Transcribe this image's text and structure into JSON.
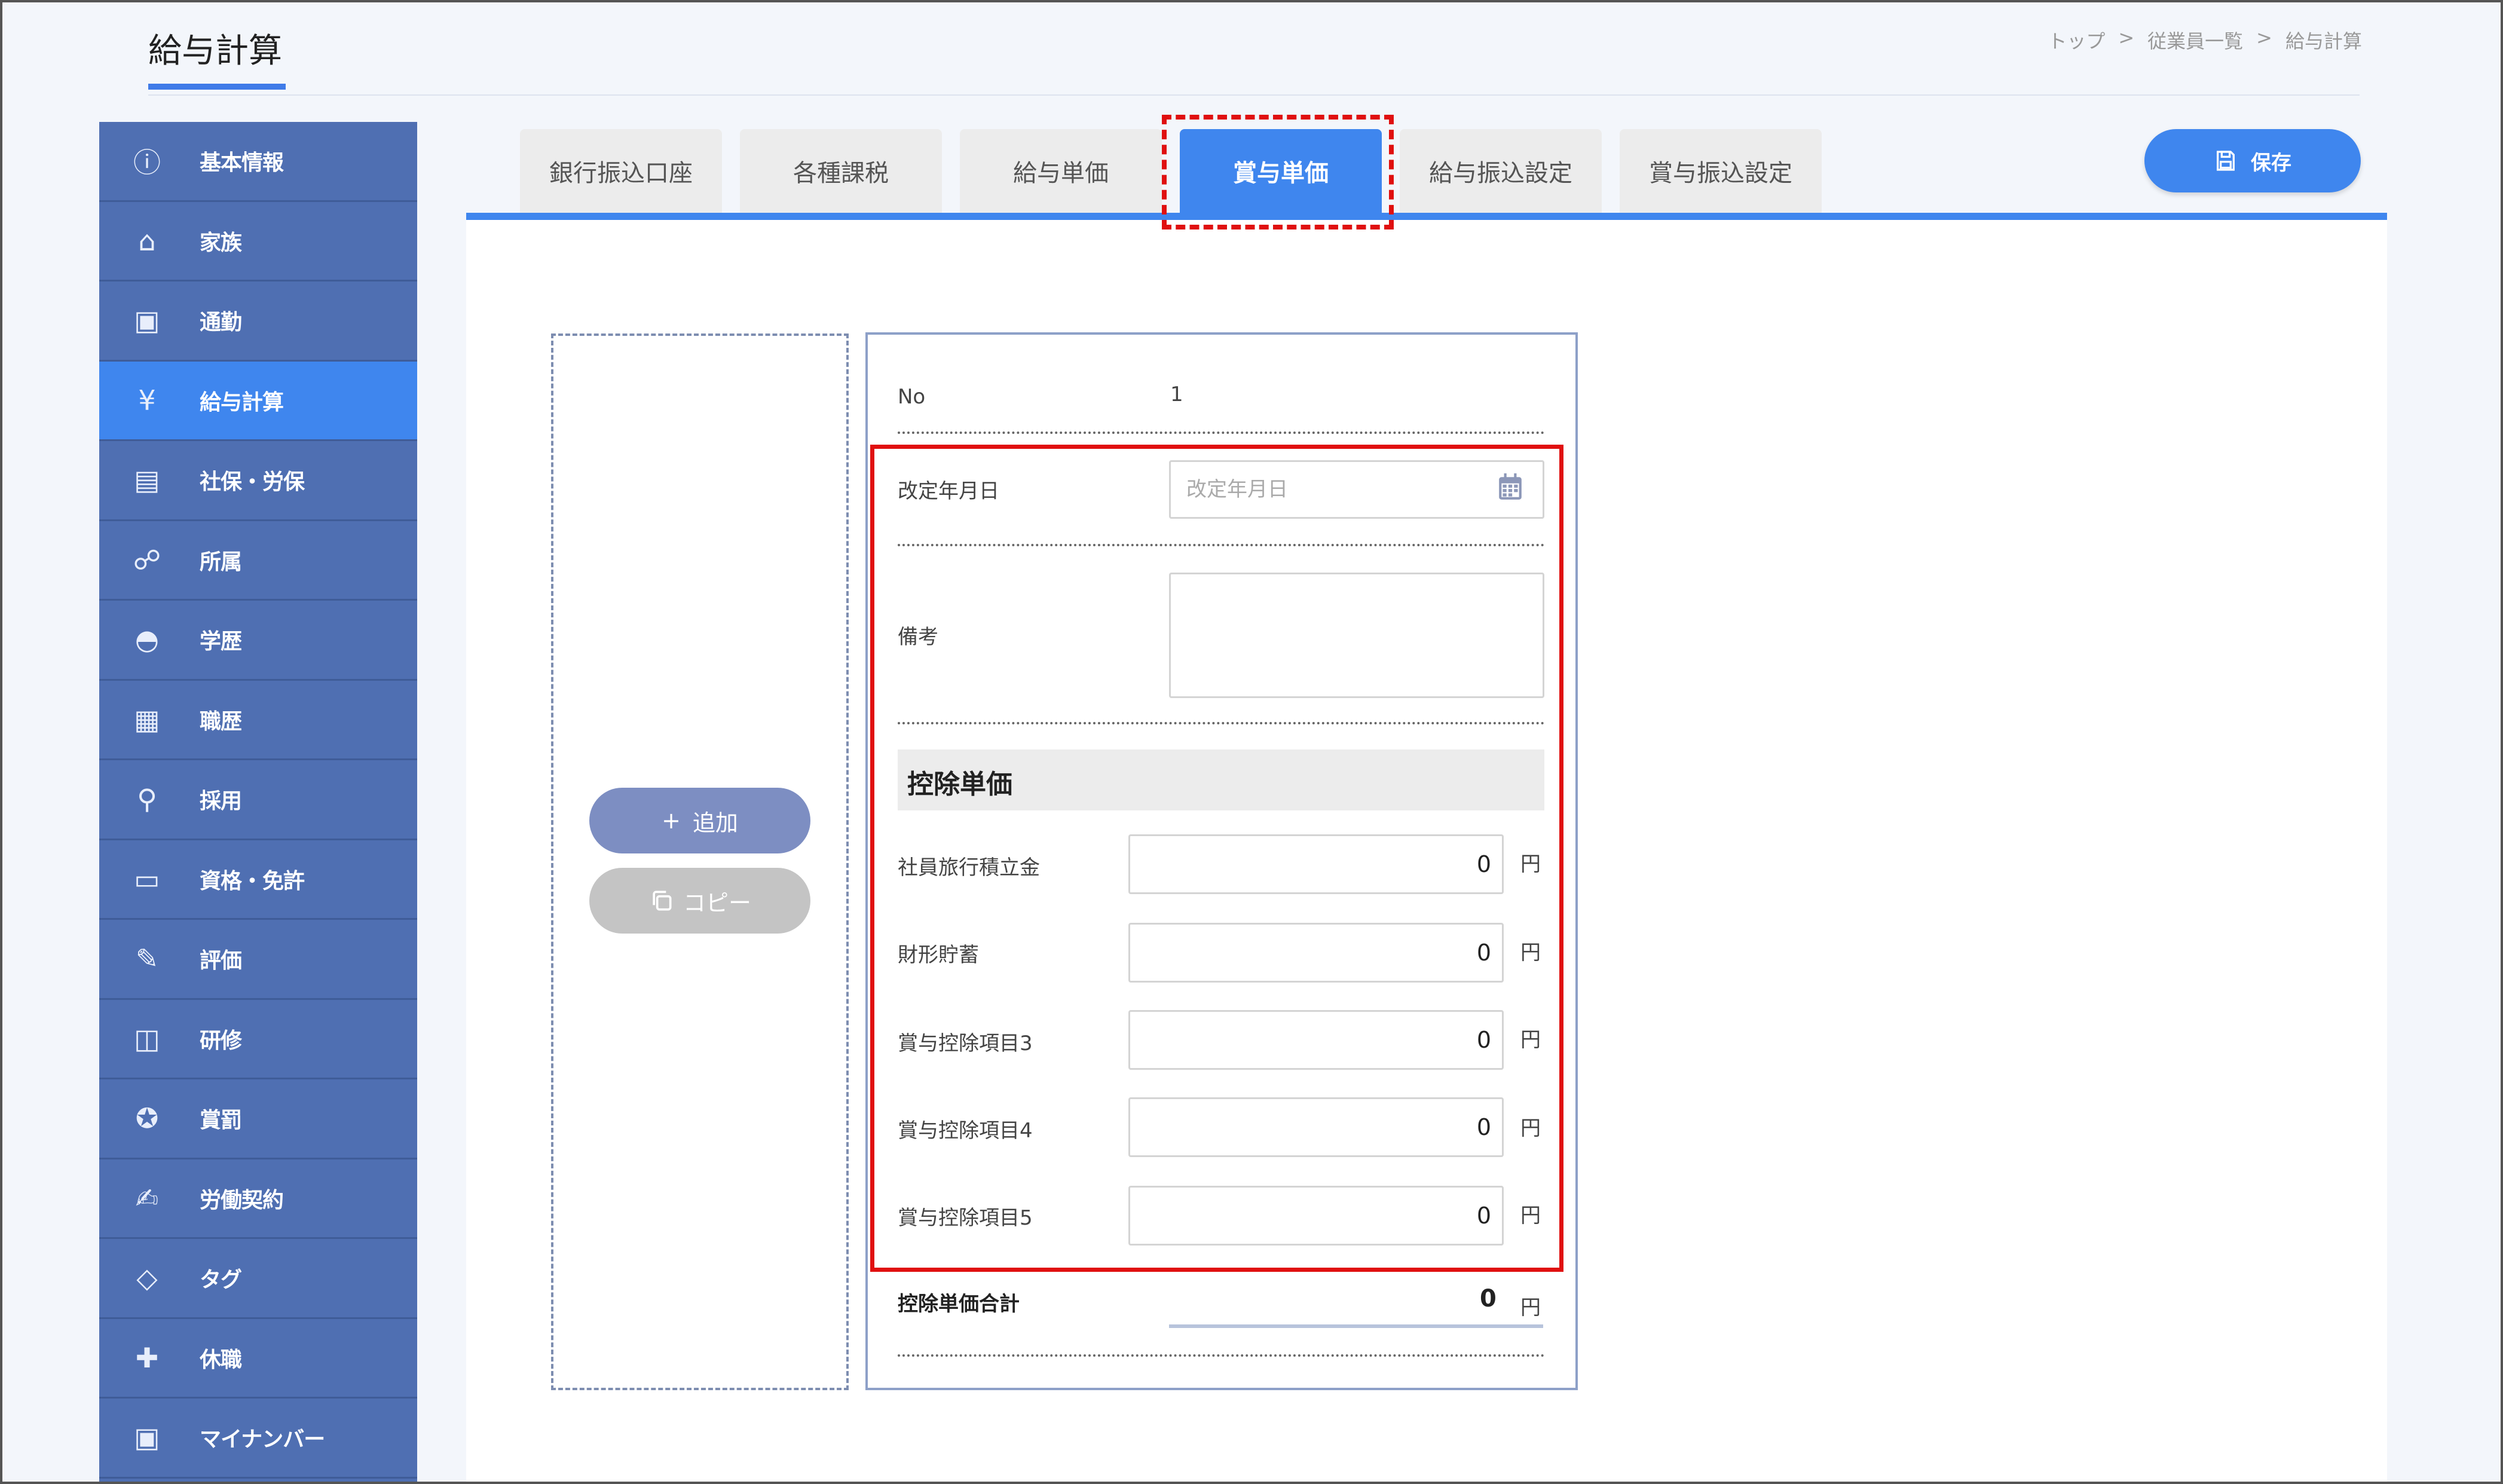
{
  "header": {
    "title": "給与計算",
    "breadcrumb": [
      "トップ",
      ">",
      "従業員一覧",
      ">",
      "給与計算"
    ]
  },
  "sidebar": {
    "items": [
      {
        "label": "基本情報",
        "icon": "info-icon"
      },
      {
        "label": "家族",
        "icon": "family-home-icon"
      },
      {
        "label": "通勤",
        "icon": "train-icon"
      },
      {
        "label": "給与計算",
        "icon": "yen-icon",
        "active": true
      },
      {
        "label": "社保・労保",
        "icon": "insurance-doc-icon"
      },
      {
        "label": "所属",
        "icon": "org-chart-icon"
      },
      {
        "label": "学歴",
        "icon": "graduation-cap-icon"
      },
      {
        "label": "職歴",
        "icon": "work-history-icon"
      },
      {
        "label": "採用",
        "icon": "recruit-search-icon"
      },
      {
        "label": "資格・免許",
        "icon": "license-card-icon"
      },
      {
        "label": "評価",
        "icon": "evaluation-icon"
      },
      {
        "label": "研修",
        "icon": "training-board-icon"
      },
      {
        "label": "賞罰",
        "icon": "award-medal-icon"
      },
      {
        "label": "労働契約",
        "icon": "contract-pen-icon"
      },
      {
        "label": "タグ",
        "icon": "tag-icon"
      },
      {
        "label": "休職",
        "icon": "medical-cross-icon"
      },
      {
        "label": "マイナンバー",
        "icon": "id-card-icon"
      }
    ]
  },
  "tabs": [
    {
      "label": "銀行振込口座"
    },
    {
      "label": "各種課税"
    },
    {
      "label": "給与単価"
    },
    {
      "label": "賞与単価",
      "active": true
    },
    {
      "label": "給与振込設定"
    },
    {
      "label": "賞与振込設定"
    }
  ],
  "toolbar": {
    "save_label": "保存",
    "save_icon": "floppy-disk-icon"
  },
  "left_panel": {
    "add_label": "追加",
    "copy_label": "コピー"
  },
  "record": {
    "no_label": "No",
    "no_value": "1",
    "date_label": "改定年月日",
    "date_placeholder": "改定年月日",
    "remarks_label": "備考",
    "section_title": "控除単価",
    "items": [
      {
        "label": "社員旅行積立金",
        "value": "0",
        "unit": "円"
      },
      {
        "label": "財形貯蓄",
        "value": "0",
        "unit": "円"
      },
      {
        "label": "賞与控除項目3",
        "value": "0",
        "unit": "円"
      },
      {
        "label": "賞与控除項目4",
        "value": "0",
        "unit": "円"
      },
      {
        "label": "賞与控除項目5",
        "value": "0",
        "unit": "円"
      }
    ],
    "total_label": "控除単価合計",
    "total_value": "0",
    "total_unit": "円"
  },
  "colors": {
    "accent": "#3f86ee",
    "sidebar": "#4f6fb2",
    "highlight": "#e01010"
  }
}
